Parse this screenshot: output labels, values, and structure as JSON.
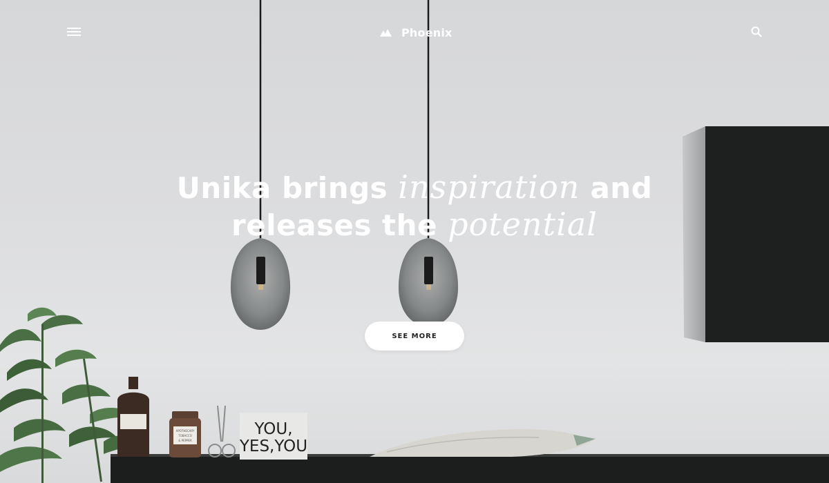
{
  "header": {
    "brand_name": "Phoenix",
    "menu_icon": "hamburger-menu-icon",
    "brand_icon": "mountain-logo-icon",
    "search_icon": "search-icon"
  },
  "hero": {
    "headline_part1": "Unika brings ",
    "headline_em1": "inspiration",
    "headline_part2": " and",
    "headline_part3": "releases the ",
    "headline_em2": "potential",
    "cta_label": "SEE MORE"
  },
  "scene": {
    "sign_line1": "YOU,",
    "sign_line2": "YES,YOU",
    "jar_label_line1": "APOTHECARY",
    "jar_label_line2": "TOBACCO",
    "jar_label_line3": "& PEPPER"
  },
  "colors": {
    "background": "#dcdddf",
    "text": "#ffffff",
    "button_bg": "#ffffff",
    "button_text": "#222222",
    "cabinet": "#1e1f1f"
  }
}
